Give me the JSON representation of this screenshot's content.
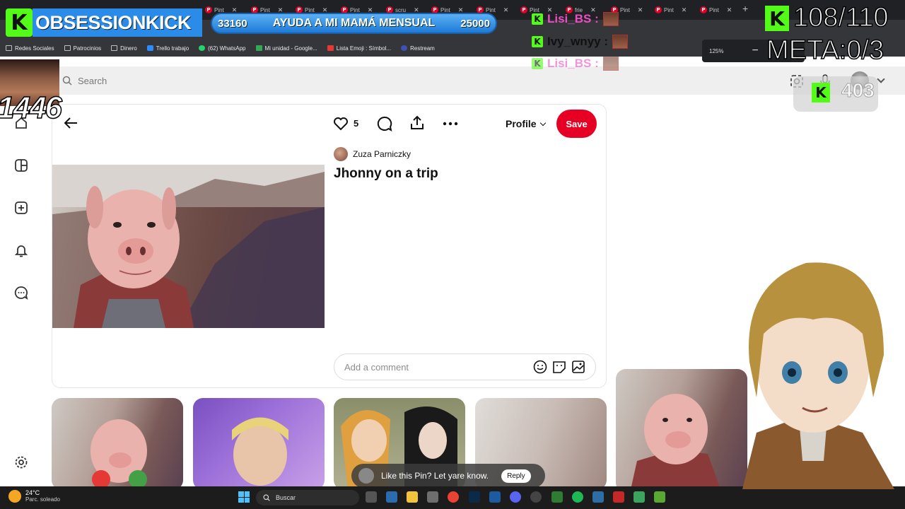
{
  "browser": {
    "tabs": [
      "Pint",
      "Pint",
      "Pint",
      "Pint",
      "scru",
      "Pint",
      "Pint",
      "Pint",
      "frie",
      "Pint",
      "Pint",
      "Pint",
      "Pint"
    ],
    "zoom": "125%",
    "bookmarks": [
      "Redes Sociales",
      "Patrocinios",
      "Dinero",
      "Trello trabajo",
      "(62) WhatsApp",
      "Mi unidad - Google...",
      "Lista Emoji : Símbol...",
      "Restream"
    ]
  },
  "header": {
    "search_placeholder": "Search"
  },
  "pin": {
    "like_count": "5",
    "profile_label": "Profile",
    "save_label": "Save",
    "author": "Zuza Parniczky",
    "title": "Jhonny on a trip",
    "comment_placeholder": "Add a comment"
  },
  "related": {
    "toast_text": "Like this Pin? Let yare know.",
    "toast_reply": "Reply"
  },
  "taskbar": {
    "temperature": "24°C",
    "weather": "Parc. soleado",
    "search_label": "Buscar"
  },
  "overlay": {
    "channel": "OBSESSIONKICK",
    "goal_current": "33160",
    "goal_label": "AYUDA A MI MAMÁ MENSUAL",
    "goal_target": "25000",
    "chat": [
      "Lisi_BS :",
      "Ivy_wnyy :",
      "Lisi_BS :"
    ],
    "counter": "108/110",
    "meta": "META:0/3",
    "sub_count": "403",
    "cam_number": "1446"
  }
}
